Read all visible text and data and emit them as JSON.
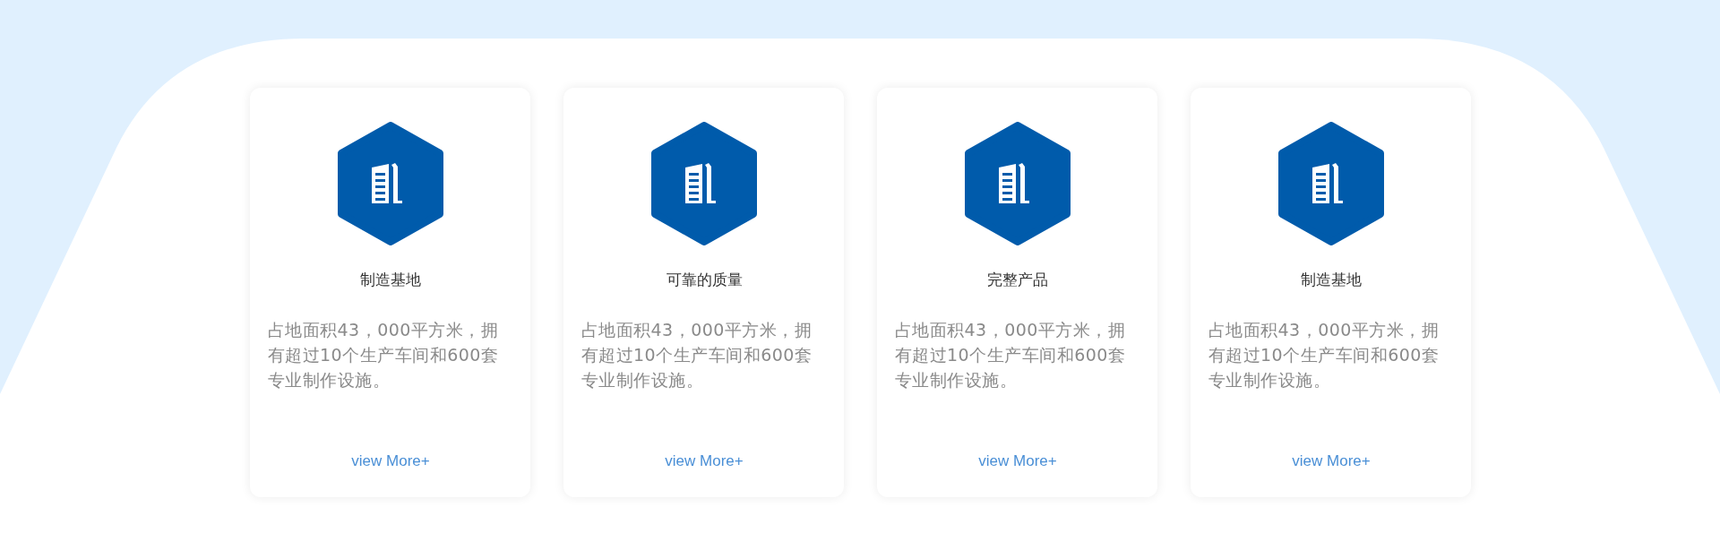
{
  "cards": [
    {
      "title": "制造基地",
      "description": "占地面积43，000平方米，拥有超过10个生产车间和600套专业制作设施。",
      "link": "view More+"
    },
    {
      "title": "可靠的质量",
      "description": "占地面积43，000平方米，拥有超过10个生产车间和600套专业制作设施。",
      "link": "view More+"
    },
    {
      "title": "完整产品",
      "description": "占地面积43，000平方米，拥有超过10个生产车间和600套专业制作设施。",
      "link": "view More+"
    },
    {
      "title": "制造基地",
      "description": "占地面积43，000平方米，拥有超过10个生产车间和600套专业制作设施。",
      "link": "view More+"
    }
  ]
}
